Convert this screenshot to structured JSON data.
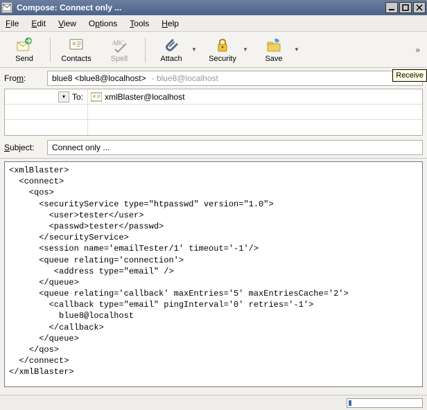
{
  "window": {
    "title": "Compose: Connect only ..."
  },
  "menubar": {
    "file": "File",
    "edit": "Edit",
    "view": "View",
    "options": "Options",
    "tools": "Tools",
    "help": "Help"
  },
  "toolbar": {
    "send": "Send",
    "contacts": "Contacts",
    "spell": "Spell",
    "attach": "Attach",
    "security": "Security",
    "save": "Save"
  },
  "tooltip_text": "Receive",
  "compose": {
    "from_label": "From:",
    "from_identity": "blue8 <blue8@localhost>",
    "from_email_gray": "- blue8@localhost",
    "to_label": "To:",
    "to_value": "xmlBlaster@localhost",
    "subject_label": "Subject:",
    "subject_value": "Connect only ..."
  },
  "body_text": "<xmlBlaster>\n  <connect>\n    <qos>\n      <securityService type=\"htpasswd\" version=\"1.0\">\n        <user>tester</user>\n        <passwd>tester</passwd>\n      </securityService>\n      <session name='emailTester/1' timeout='-1'/>\n      <queue relating='connection'>\n         <address type=\"email\" />\n      </queue>\n      <queue relating='callback' maxEntries='5' maxEntriesCache='2'>\n        <callback type=\"email\" pingInterval='0' retries='-1'>\n          blue8@localhost\n        </callback>\n      </queue>\n    </qos>\n  </connect>\n</xmlBlaster>"
}
